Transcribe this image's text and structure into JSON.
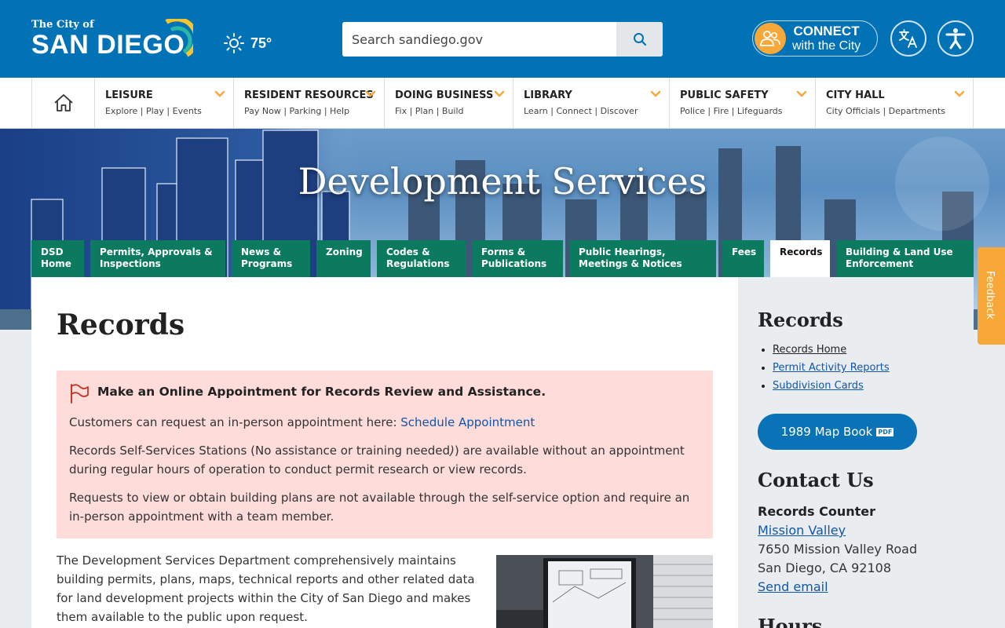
{
  "header": {
    "logo_small": "The City of",
    "logo_big": "SAN DIEGO",
    "weather_temp": "75°",
    "search_placeholder": "Search sandiego.gov",
    "connect_line1": "CONNECT",
    "connect_line2": "with the City"
  },
  "nav": {
    "items": [
      {
        "title": "LEISURE",
        "sub": "Explore | Play | Events"
      },
      {
        "title": "RESIDENT RESOURCES",
        "sub": "Pay Now | Parking | Help"
      },
      {
        "title": "DOING BUSINESS",
        "sub": "Fix | Plan | Build"
      },
      {
        "title": "LIBRARY",
        "sub": "Learn | Connect | Discover"
      },
      {
        "title": "PUBLIC SAFETY",
        "sub": "Police | Fire | Lifeguards"
      },
      {
        "title": "CITY HALL",
        "sub": "City Officials | Departments"
      }
    ]
  },
  "hero": {
    "title": "Development Services"
  },
  "tabs": [
    {
      "l1": "DSD",
      "l2": "Home"
    },
    {
      "l1": "Permits, Approvals &",
      "l2": "Inspections"
    },
    {
      "l1": "News &",
      "l2": "Programs"
    },
    {
      "l1": "Zoning",
      "l2": ""
    },
    {
      "l1": "Codes &",
      "l2": "Regulations"
    },
    {
      "l1": "Forms &",
      "l2": "Publications"
    },
    {
      "l1": "Public Hearings,",
      "l2": "Meetings & Notices"
    },
    {
      "l1": "Fees",
      "l2": ""
    },
    {
      "l1": "Records",
      "l2": ""
    },
    {
      "l1": "Building & Land Use",
      "l2": "Enforcement"
    }
  ],
  "main": {
    "title": "Records",
    "alert_title": "Make an Online Appointment for Records Review and Assistance.",
    "alert_p1": "Customers can request an in-person appointment here: ",
    "alert_p1_link": "Schedule Appointment",
    "alert_p2_a": "Records Self-Services Stations (No assistance or training needed",
    "alert_p2_b": ") are available without an appointment during regular hours of operation to conduct permit research or view records.",
    "alert_p3": "Requests to view or obtain building plans are not available through the self-service option and require an in-person appointment with a team member.",
    "body": "The Development Services Department comprehensively maintains building permits, plans, maps, technical reports and other related data for land development projects within the City of San Diego and makes them available to the public upon request."
  },
  "sidebar": {
    "heading": "Records",
    "links": [
      "Records Home",
      "Permit Activity Reports",
      "Subdivision Cards"
    ],
    "map_button": "1989 Map Book",
    "pdf_badge": "PDF",
    "contact_heading": "Contact Us",
    "contact_name": "Records Counter",
    "contact_location": "Mission Valley",
    "contact_street": "7650 Mission Valley Road",
    "contact_city": "San Diego, CA 92108",
    "contact_email": "Send email",
    "hours_heading": "Hours"
  },
  "feedback": "Feedback",
  "colors": {
    "header_blue": "#0072b5",
    "tab_green": "#0c7a5f",
    "accent_orange": "#f7a839",
    "alert_bg": "#fddcda",
    "button_blue": "#0a73b8"
  }
}
